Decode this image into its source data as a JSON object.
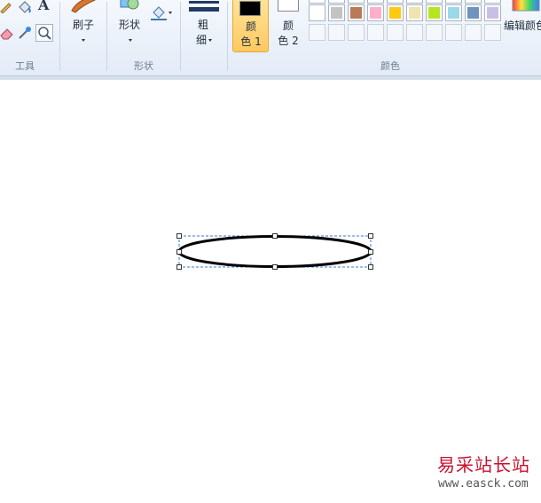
{
  "ribbon": {
    "groups": {
      "tools_label": "工具",
      "shapes_label": "形状",
      "colors_label": "颜色"
    },
    "brushes_label": "刷子",
    "shapes_label": "形状",
    "size_label_line1": "粗",
    "size_label_line2": "细",
    "color1_line1": "颜",
    "color1_line2": "色 1",
    "color2_line1": "颜",
    "color2_line2": "色 2",
    "edit_colors_label": "编辑颜色",
    "color1_value": "#000000",
    "color2_value": "#ffffff",
    "palette_row2": [
      "#ffffff",
      "#c3c3c3",
      "#b97a57",
      "#ffaec9",
      "#ffc90e",
      "#efe4b0",
      "#b5e61d",
      "#99d9ea",
      "#7092be",
      "#c8bfe7"
    ],
    "palette_row3_count": 10
  },
  "canvas": {
    "shape": "ellipse",
    "stroke_color": "#000000",
    "selection_color": "#3a7bd5"
  },
  "watermark": {
    "site_name": "易采站长站",
    "url": "www.easck.com"
  }
}
